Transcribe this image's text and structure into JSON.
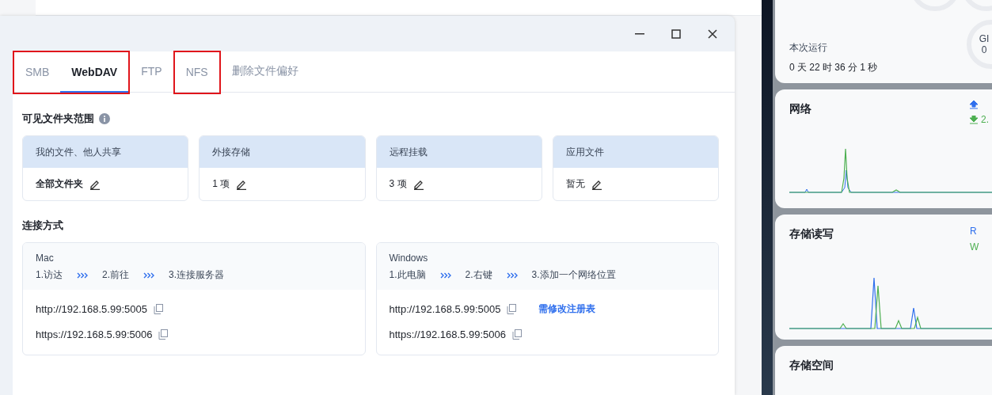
{
  "tabs": [
    {
      "label": "SMB",
      "selected": false,
      "boxed": true
    },
    {
      "label": "WebDAV",
      "selected": true,
      "boxed": true
    },
    {
      "label": "FTP",
      "selected": false,
      "boxed": false
    },
    {
      "label": "NFS",
      "selected": false,
      "boxed": true
    },
    {
      "label": "删除文件偏好",
      "selected": false,
      "boxed": false
    }
  ],
  "visible_scope": {
    "title": "可见文件夹范围",
    "cards": [
      {
        "header": "我的文件、他人共享",
        "value": "全部文件夹",
        "bold": true
      },
      {
        "header": "外接存储",
        "value": "1 项",
        "bold": false
      },
      {
        "header": "远程挂载",
        "value": "3 项",
        "bold": false
      },
      {
        "header": "应用文件",
        "value": "暂无",
        "bold": false
      }
    ]
  },
  "connection": {
    "title": "连接方式",
    "platforms": [
      {
        "name": "Mac",
        "steps": [
          "1.访达",
          "2.前往",
          "3.连接服务器"
        ],
        "urls": [
          {
            "text": "http://192.168.5.99:5005"
          },
          {
            "text": "https://192.168.5.99:5006"
          }
        ]
      },
      {
        "name": "Windows",
        "steps": [
          "1.此电脑",
          "2.右键",
          "3.添加一个网络位置"
        ],
        "urls": [
          {
            "text": "http://192.168.5.99:5005",
            "link": "需修改注册表"
          },
          {
            "text": "https://192.168.5.99:5006"
          }
        ]
      }
    ]
  },
  "side_panel": {
    "uptime": {
      "label": "本次运行",
      "value": "0 天 22 时 36 分 1 秒"
    },
    "gauge": {
      "label": "GI",
      "value": "0"
    },
    "network": {
      "title": "网络",
      "download": "2."
    },
    "disk_io": {
      "title": "存储读写",
      "read": "R",
      "write": "W"
    },
    "storage": {
      "title": "存储空间"
    }
  }
}
